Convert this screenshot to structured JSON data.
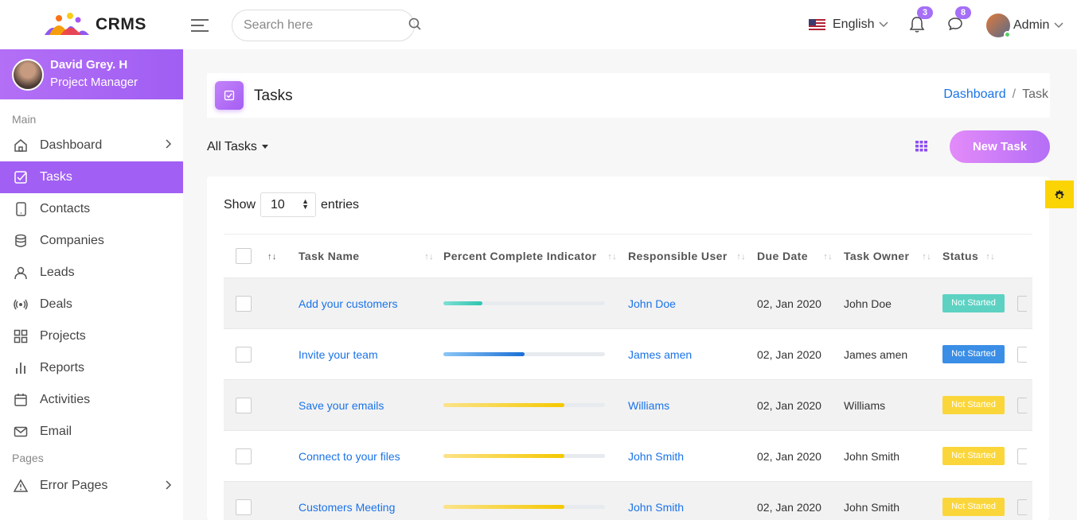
{
  "header": {
    "logo_text": "CRMS",
    "search_placeholder": "Search here",
    "language": "English",
    "notifications_count": "3",
    "messages_count": "8",
    "user_label": "Admin"
  },
  "sidebar": {
    "profile_name": "David Grey. H",
    "profile_role": "Project Manager",
    "section_main": "Main",
    "section_pages": "Pages",
    "items": [
      {
        "label": "Dashboard",
        "icon": "home-icon"
      },
      {
        "label": "Tasks",
        "icon": "check-square-icon"
      },
      {
        "label": "Contacts",
        "icon": "tablet-icon"
      },
      {
        "label": "Companies",
        "icon": "database-icon"
      },
      {
        "label": "Leads",
        "icon": "user-icon"
      },
      {
        "label": "Deals",
        "icon": "broadcast-icon"
      },
      {
        "label": "Projects",
        "icon": "grid-icon"
      },
      {
        "label": "Reports",
        "icon": "bar-chart-icon"
      },
      {
        "label": "Activities",
        "icon": "calendar-icon"
      },
      {
        "label": "Email",
        "icon": "mail-icon"
      }
    ],
    "pages_items": [
      {
        "label": "Error Pages",
        "icon": "alert-triangle-icon"
      }
    ]
  },
  "page": {
    "title": "Tasks",
    "breadcrumb_link": "Dashboard",
    "breadcrumb_current": "Task",
    "filter_label": "All Tasks",
    "new_task_label": "New Task"
  },
  "table": {
    "show_label": "Show",
    "entries_value": "10",
    "entries_label": "entries",
    "columns": [
      "Task Name",
      "Percent Complete Indicator",
      "Responsible User",
      "Due Date",
      "Task Owner",
      "Status"
    ],
    "rows": [
      {
        "task": "Add your customers",
        "progress": 0.24,
        "bar_color": "teal",
        "responsible": "John Doe",
        "due": "02, Jan 2020",
        "owner": "John Doe",
        "status": "Not Started",
        "status_color": "#5dd2c3"
      },
      {
        "task": "Invite your team",
        "progress": 0.5,
        "bar_color": "blue",
        "responsible": "James amen",
        "due": "02, Jan 2020",
        "owner": "James amen",
        "status": "Not Started",
        "status_color": "#3a8ee6"
      },
      {
        "task": "Save your emails",
        "progress": 0.75,
        "bar_color": "yellow",
        "responsible": "Williams",
        "due": "02, Jan 2020",
        "owner": "Williams",
        "status": "Not Started",
        "status_color": "#fbd63b"
      },
      {
        "task": "Connect to your files",
        "progress": 0.75,
        "bar_color": "yellow",
        "responsible": "John Smith",
        "due": "02, Jan 2020",
        "owner": "John Smith",
        "status": "Not Started",
        "status_color": "#fbd63b"
      },
      {
        "task": "Customers Meeting",
        "progress": 0.75,
        "bar_color": "yellow",
        "responsible": "John Smith",
        "due": "02, Jan 2020",
        "owner": "John Smith",
        "status": "Not Started",
        "status_color": "#fbd63b"
      }
    ]
  },
  "colors": {
    "accent": "#a15ff3",
    "link": "#1a73e8",
    "settings_tab": "#fad405"
  }
}
